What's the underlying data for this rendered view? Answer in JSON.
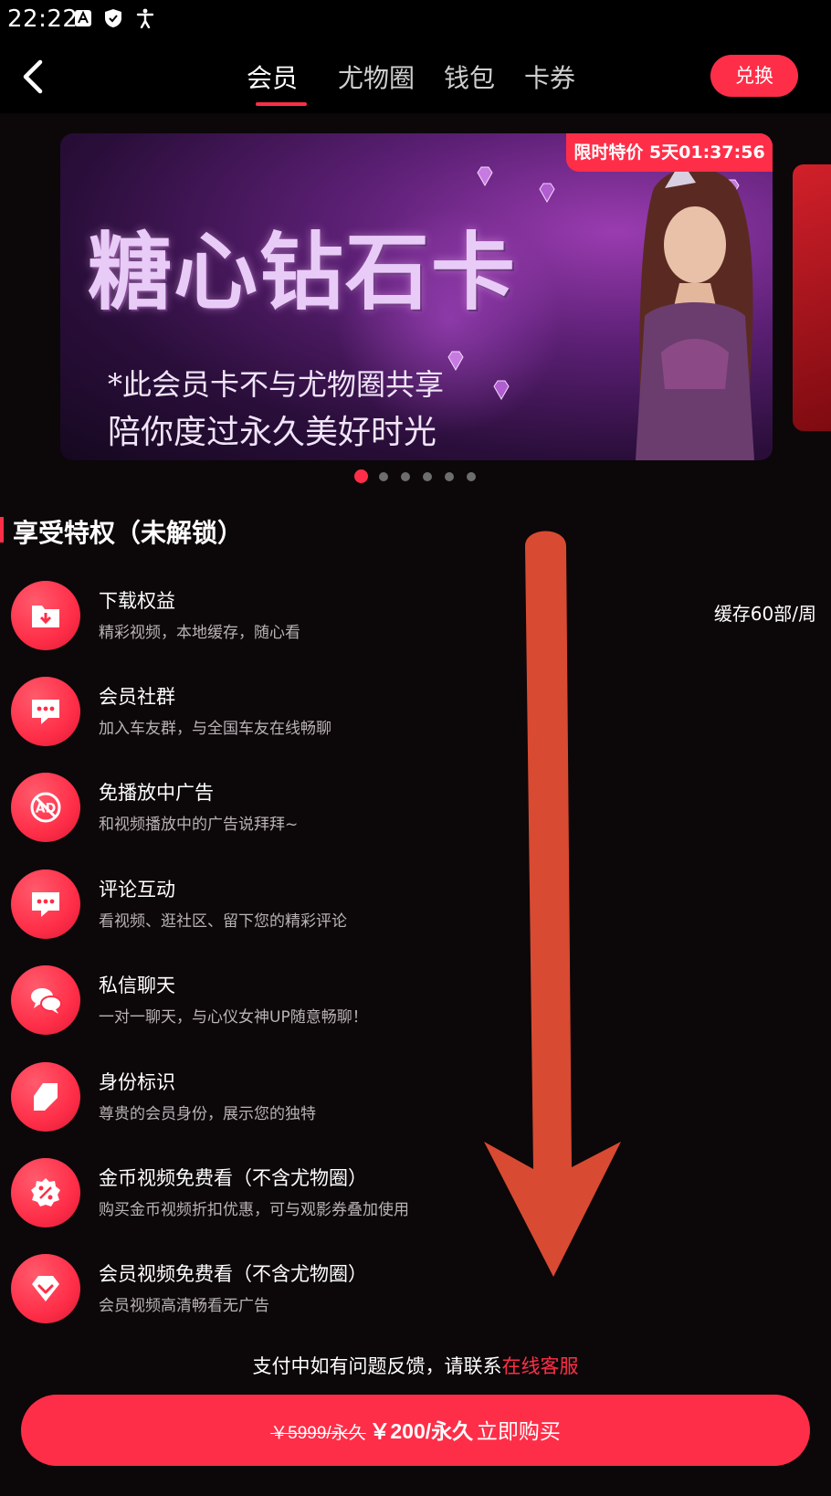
{
  "status_bar": {
    "time": "22:22",
    "icons": [
      "font-icon",
      "shield-icon",
      "accessibility-icon"
    ]
  },
  "header": {
    "tabs": [
      {
        "label": "会员",
        "active": true
      },
      {
        "label": "尤物圈",
        "active": false
      },
      {
        "label": "钱包",
        "active": false
      },
      {
        "label": "卡券",
        "active": false
      }
    ],
    "redeem_label": "兑换"
  },
  "banner": {
    "title": "糖心钻石卡",
    "line1": "*此会员卡不与尤物圈共享",
    "line2": "陪你度过永久美好时光",
    "badge": "限时特价 5天01:37:56",
    "slide_count": 6,
    "active_slide": 0
  },
  "privileges": {
    "section_title": "享受特权（未解锁）",
    "items": [
      {
        "icon": "download-folder-icon",
        "title": "下载权益",
        "desc": "精彩视频，本地缓存，随心看",
        "extra": "缓存60部/周"
      },
      {
        "icon": "chat-bubble-icon",
        "title": "会员社群",
        "desc": "加入车友群，与全国车友在线畅聊",
        "extra": ""
      },
      {
        "icon": "no-ad-icon",
        "title": "免播放中广告",
        "desc": "和视频播放中的广告说拜拜~",
        "extra": ""
      },
      {
        "icon": "comment-icon",
        "title": "评论互动",
        "desc": "看视频、逛社区、留下您的精彩评论",
        "extra": ""
      },
      {
        "icon": "private-message-icon",
        "title": "私信聊天",
        "desc": "一对一聊天，与心仪女神UP随意畅聊！",
        "extra": ""
      },
      {
        "icon": "identity-badge-icon",
        "title": "身份标识",
        "desc": "尊贵的会员身份，展示您的独特",
        "extra": ""
      },
      {
        "icon": "discount-icon",
        "title": "金币视频免费看（不含尤物圈）",
        "desc": "购买金币视频折扣优惠，可与观影券叠加使用",
        "extra": ""
      },
      {
        "icon": "diamond-icon",
        "title": "会员视频免费看（不含尤物圈）",
        "desc": "会员视频高清畅看无广告",
        "extra": ""
      }
    ]
  },
  "footer": {
    "help_text": "支付中如有问题反馈，请联系",
    "help_link": "在线客服",
    "old_price": "￥5999/永久",
    "price": "￥200/永久",
    "cta": "立即购买"
  },
  "colors": {
    "accent": "#ff2e48",
    "background": "#0c0709",
    "arrow": "#d84a32"
  }
}
